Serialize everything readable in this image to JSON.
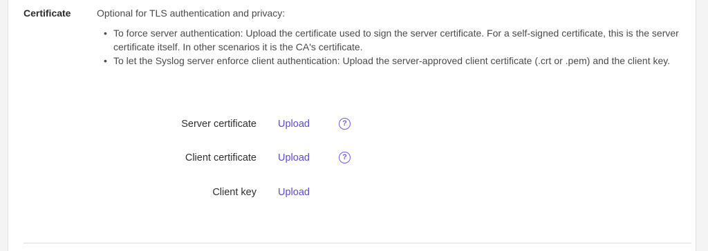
{
  "certificate": {
    "label": "Certificate",
    "intro": "Optional for TLS authentication and privacy:",
    "bullets": [
      "To force server authentication: Upload the certificate used to sign the server certificate. For a self-signed certificate, this is the server certificate itself. In other scenarios it is the CA's certificate.",
      "To let the Syslog server enforce client authentication: Upload the server-approved client certificate (.crt or .pem) and the client key."
    ],
    "rows": [
      {
        "label": "Server certificate",
        "action": "Upload",
        "help_icon": "question-circle-icon"
      },
      {
        "label": "Client certificate",
        "action": "Upload",
        "help_icon": "question-circle-icon"
      },
      {
        "label": "Client key",
        "action": "Upload"
      }
    ]
  },
  "colors": {
    "accent": "#5b4ecb",
    "text": "#3a3a3a",
    "background": "#f4f4f5"
  }
}
